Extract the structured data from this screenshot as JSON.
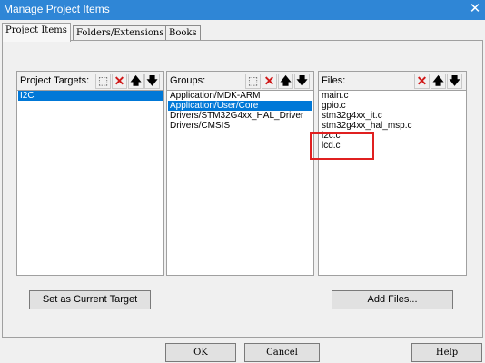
{
  "window": {
    "title": "Manage Project Items",
    "close_glyph": "✕"
  },
  "tabs": [
    {
      "label": "Project Items",
      "active": true
    },
    {
      "label": "Folders/Extensions"
    },
    {
      "label": "Books"
    }
  ],
  "targets": {
    "label": "Project Targets:",
    "items": [
      "I2C"
    ],
    "selected": 0
  },
  "groups": {
    "label": "Groups:",
    "items": [
      "Application/MDK-ARM",
      "Application/User/Core",
      "Drivers/STM32G4xx_HAL_Driver",
      "Drivers/CMSIS"
    ],
    "selected": 1
  },
  "files": {
    "label": "Files:",
    "items": [
      "main.c",
      "gpio.c",
      "stm32g4xx_it.c",
      "stm32g4xx_hal_msp.c",
      "i2c.c",
      "lcd.c"
    ]
  },
  "toolbar": {
    "new_icon": "new-item-icon",
    "delete_icon": "delete-x-icon",
    "up_icon": "move-up-arrow-icon",
    "down_icon": "move-down-arrow-icon",
    "new_glyph": "⬚",
    "delete_glyph": "✕",
    "up_glyph": "🡅",
    "down_glyph": "🡇"
  },
  "buttons": {
    "set_target": "Set as Current Target",
    "add_files": "Add Files...",
    "ok": "OK",
    "cancel": "Cancel",
    "help": "Help"
  },
  "colors": {
    "titlebar": "#2f86d6",
    "selection": "#0078d7",
    "highlight_box": "#e02020"
  }
}
